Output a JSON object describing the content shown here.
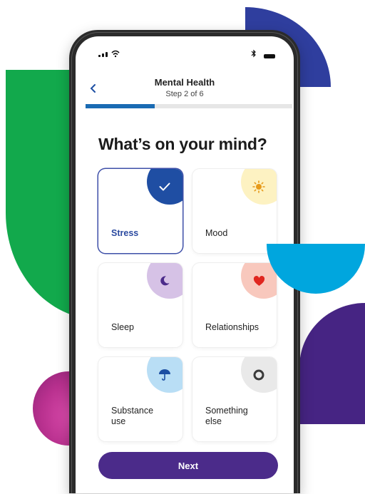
{
  "header": {
    "title": "Mental Health",
    "step": "Step 2 of 6"
  },
  "progress": {
    "current_step": 2,
    "total_steps": 6
  },
  "question": "What’s on your mind?",
  "options": [
    {
      "label": "Stress",
      "selected": true,
      "icon": "check-icon",
      "badge_color": "#1f4ea3"
    },
    {
      "label": "Mood",
      "selected": false,
      "icon": "sun-icon",
      "badge_color": "#fdf2c2"
    },
    {
      "label": "Sleep",
      "selected": false,
      "icon": "moon-icon",
      "badge_color": "#d6c2e6"
    },
    {
      "label": "Relationships",
      "selected": false,
      "icon": "heart-icon",
      "badge_color": "#f8c8bd"
    },
    {
      "label": "Substance use",
      "selected": false,
      "icon": "umbrella-icon",
      "badge_color": "#b9def5"
    },
    {
      "label": "Something else",
      "selected": false,
      "icon": "circle-icon",
      "badge_color": "#e9e9e9"
    }
  ],
  "footer": {
    "next_label": "Next"
  },
  "colors": {
    "primary": "#4b2b8a",
    "accent_blue": "#1a6bb3",
    "selected_border": "#3e4fa8"
  }
}
